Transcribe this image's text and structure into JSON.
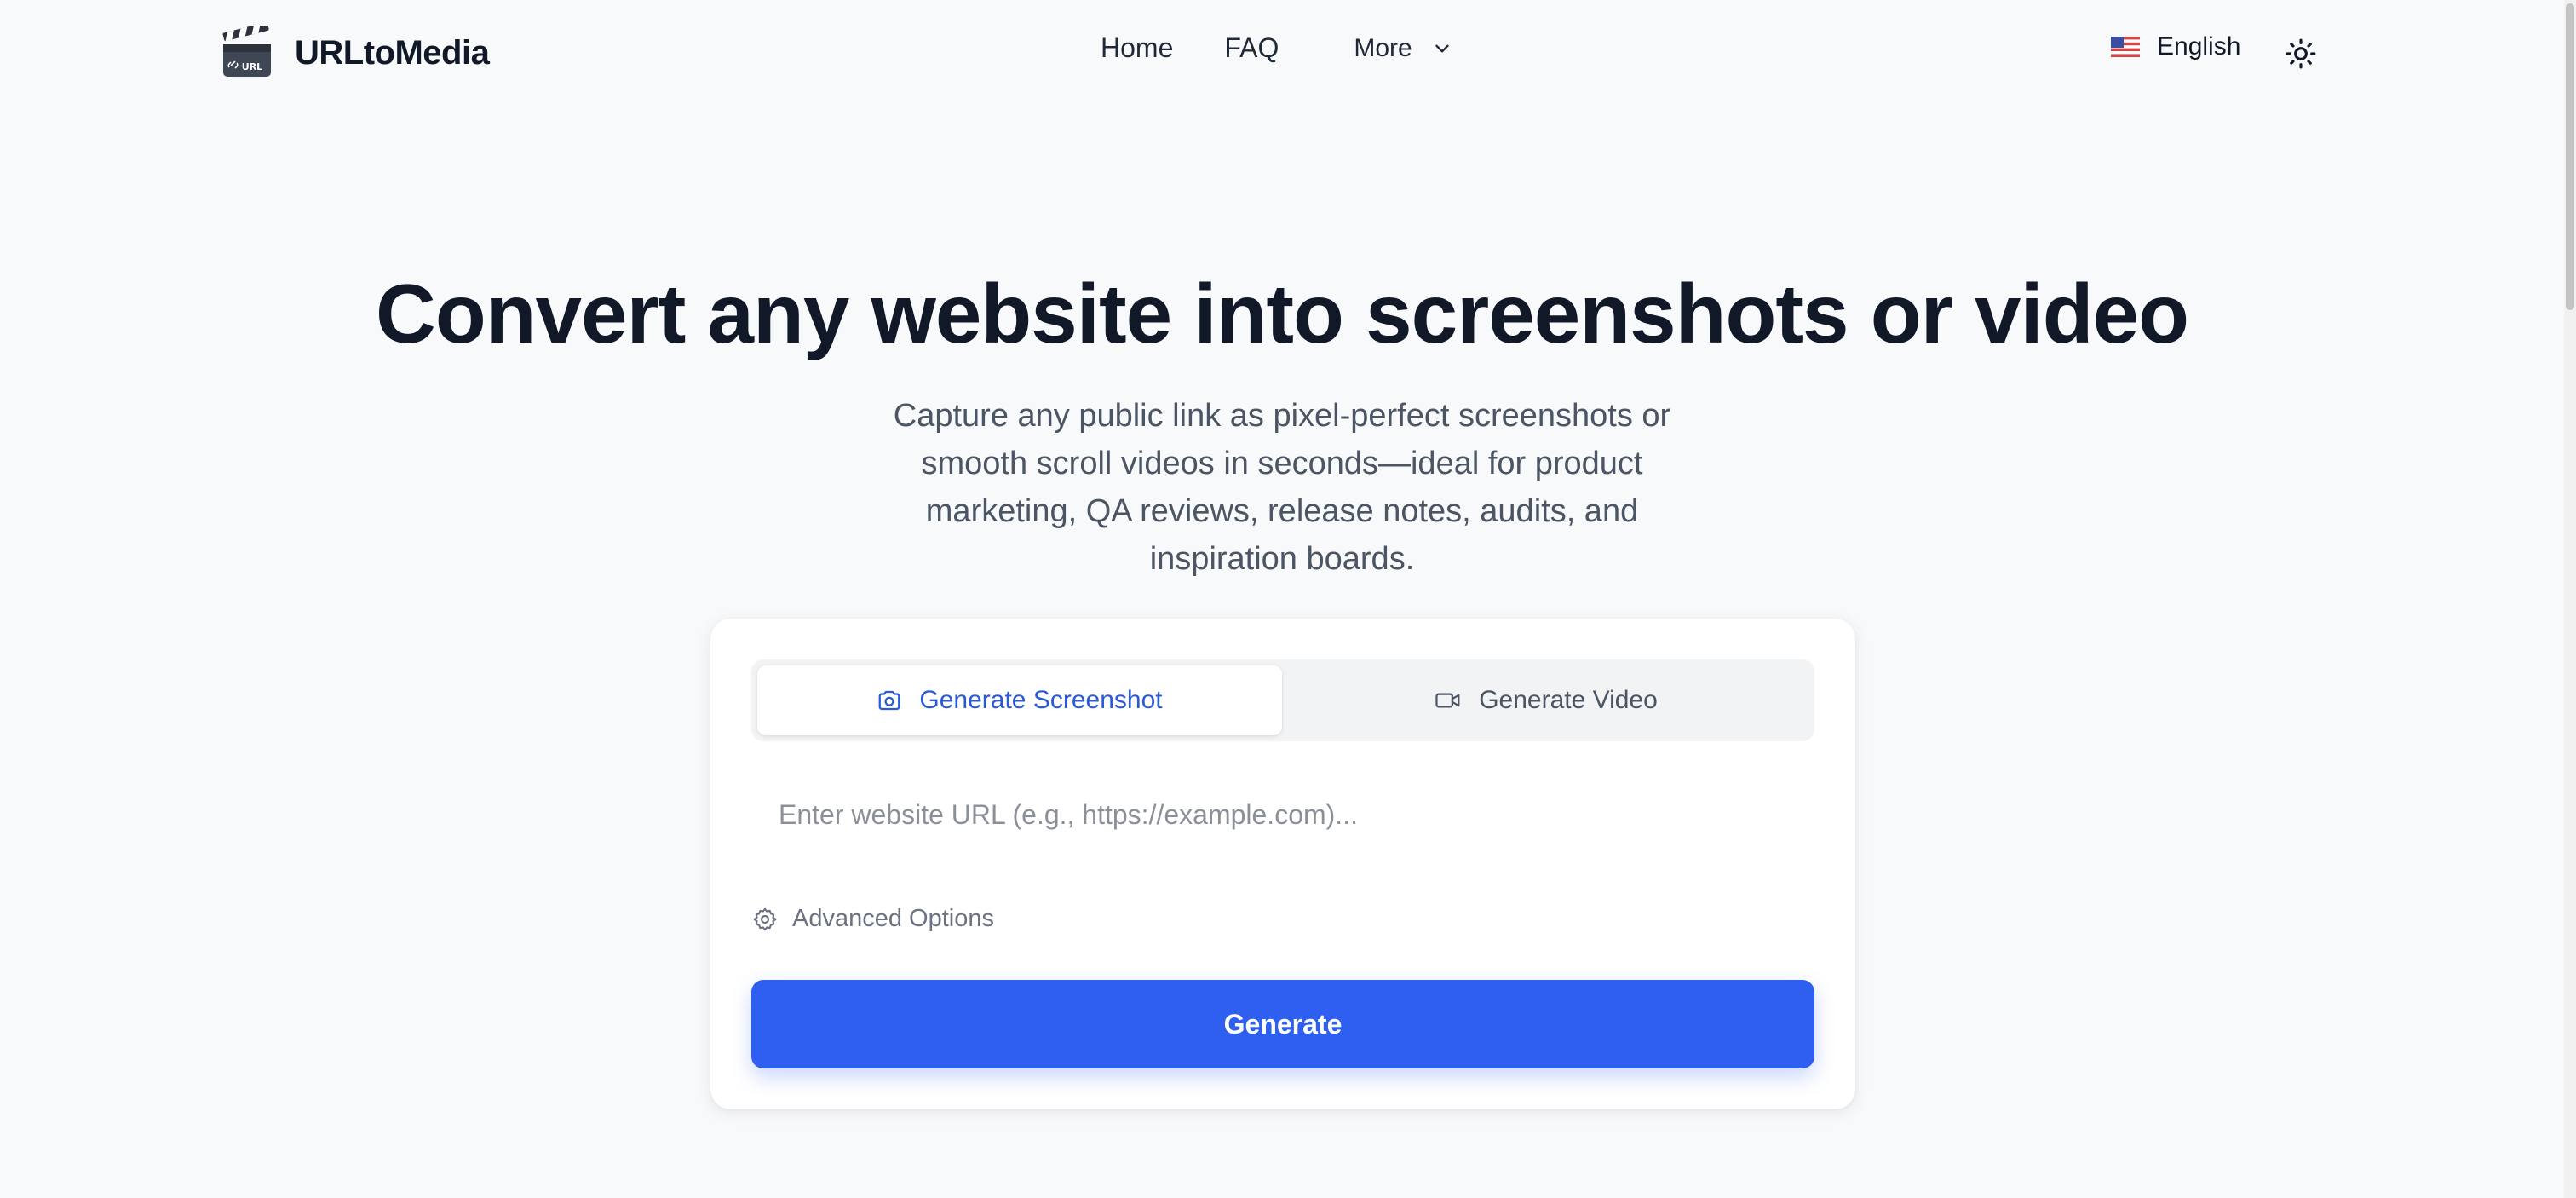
{
  "header": {
    "brand": "URLtoMedia",
    "logo_icon": "clapperboard-icon",
    "logo_badge": "URL",
    "nav": {
      "home": "Home",
      "faq": "FAQ",
      "more": "More"
    },
    "language": "English",
    "language_flag": "us-flag-icon",
    "theme_icon": "sun-icon"
  },
  "hero": {
    "title": "Convert any website into screenshots or video",
    "subtitle": "Capture any public link as pixel-perfect screenshots or smooth scroll videos in seconds—ideal for product marketing, QA reviews, release notes, audits, and inspiration boards."
  },
  "card": {
    "tabs": [
      {
        "label": "Generate Screenshot",
        "icon": "camera-icon",
        "active": true
      },
      {
        "label": "Generate Video",
        "icon": "video-camera-icon",
        "active": false
      }
    ],
    "url_input": {
      "value": "",
      "placeholder": "Enter website URL (e.g., https://example.com)..."
    },
    "advanced_options": "Advanced Options",
    "generate_button": "Generate"
  },
  "colors": {
    "accent": "#2f5ff0",
    "active_tab_text": "#2b5ad8",
    "background": "#f8f9fb"
  }
}
